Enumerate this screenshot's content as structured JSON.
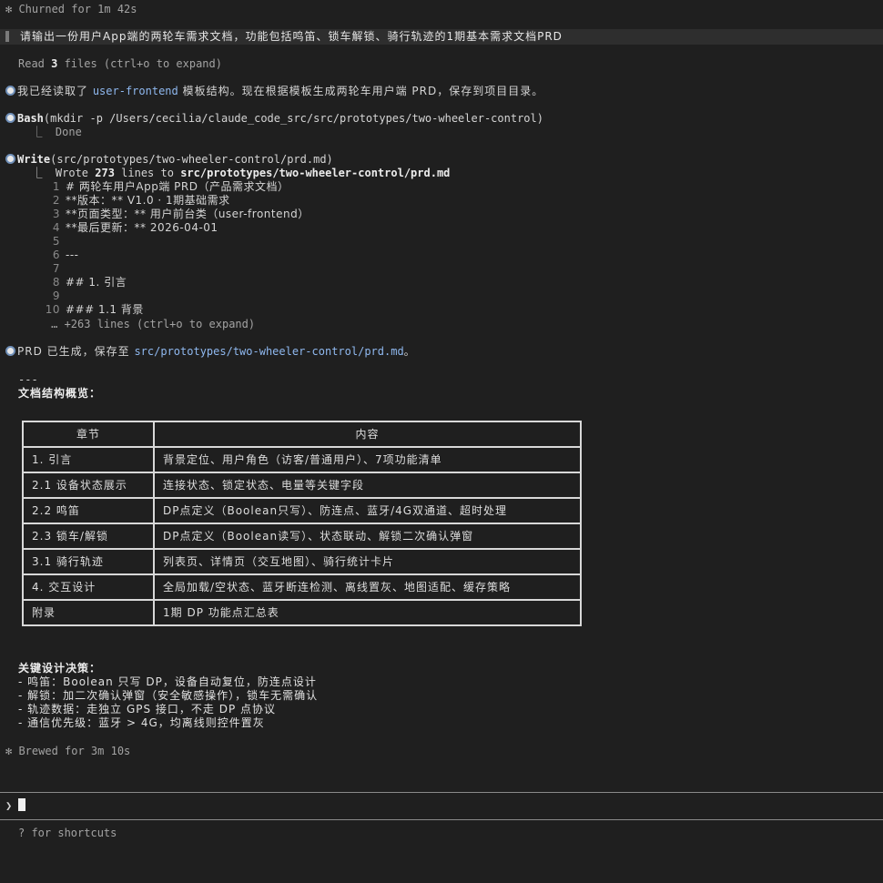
{
  "status_churned": "✻ Churned for 1m 42s",
  "user_prompt": "请输出一份用户App端的两轮车需求文档，功能包括鸣笛、锁车解锁、骑行轨迹的1期基本需求文档PRD",
  "read_files": {
    "prefix": "Read ",
    "count": "3",
    "suffix": " files (ctrl+o to expand)"
  },
  "msg1": {
    "pre": "我已经读取了 ",
    "link": "user-frontend",
    "post": " 模板结构。现在根据模板生成两轮车用户端 PRD，保存到项目目录。"
  },
  "bash_tool": {
    "name": "Bash",
    "args": "(mkdir -p /Users/cecilia/claude_code_src/src/prototypes/two-wheeler-control)",
    "result": "  ⎿  Done"
  },
  "write_tool": {
    "name": "Write",
    "args": "(src/prototypes/two-wheeler-control/prd.md)",
    "result_pre": "  ⎿  Wrote ",
    "count": "273",
    "result_mid": " lines to ",
    "path": "src/prototypes/two-wheeler-control/prd.md",
    "lines": [
      {
        "n": "1",
        "t": "# 两轮车用户App端 PRD（产品需求文档）"
      },
      {
        "n": "2",
        "t": "**版本：** V1.0 · 1期基础需求"
      },
      {
        "n": "3",
        "t": "**页面类型：** 用户前台类（user-frontend）"
      },
      {
        "n": "4",
        "t": "**最后更新：** 2026-04-01"
      },
      {
        "n": "5",
        "t": ""
      },
      {
        "n": "6",
        "t": "---"
      },
      {
        "n": "7",
        "t": ""
      },
      {
        "n": "8",
        "t": "## 1. 引言"
      },
      {
        "n": "9",
        "t": ""
      },
      {
        "n": "10",
        "t": "### 1.1 背景"
      }
    ],
    "more": "     … +263 lines (ctrl+o to expand)"
  },
  "msg2": {
    "pre": "PRD 已生成，保存至 ",
    "link": "src/prototypes/two-wheeler-control/prd.md",
    "post": "。"
  },
  "separator": "---",
  "overview_title": "文档结构概览：",
  "table": {
    "headers": [
      "章节",
      "内容"
    ],
    "rows": [
      [
        "1. 引言",
        "背景定位、用户角色（访客/普通用户）、7项功能清单"
      ],
      [
        "2.1 设备状态展示",
        "连接状态、锁定状态、电量等关键字段"
      ],
      [
        "2.2 鸣笛",
        "DP点定义（Boolean只写）、防连点、蓝牙/4G双通道、超时处理"
      ],
      [
        "2.3 锁车/解锁",
        "DP点定义（Boolean读写）、状态联动、解锁二次确认弹窗"
      ],
      [
        "3.1 骑行轨迹",
        "列表页、详情页（交互地图）、骑行统计卡片"
      ],
      [
        "4. 交互设计",
        "全局加载/空状态、蓝牙断连检测、离线置灰、地图适配、缓存策略"
      ],
      [
        "附录",
        "1期 DP 功能点汇总表"
      ]
    ]
  },
  "decisions_title": "关键设计决策：",
  "decisions": [
    "- 鸣笛：Boolean 只写 DP，设备自动复位，防连点设计",
    "- 解锁：加二次确认弹窗（安全敏感操作），锁车无需确认",
    "- 轨迹数据：走独立 GPS 接口，不走 DP 点协议",
    "- 通信优先级：蓝牙 > 4G，均离线则控件置灰"
  ],
  "status_brewed": "✻ Brewed for 3m 10s",
  "prompt_symbol": "❯",
  "shortcuts_hint": "? for shortcuts"
}
